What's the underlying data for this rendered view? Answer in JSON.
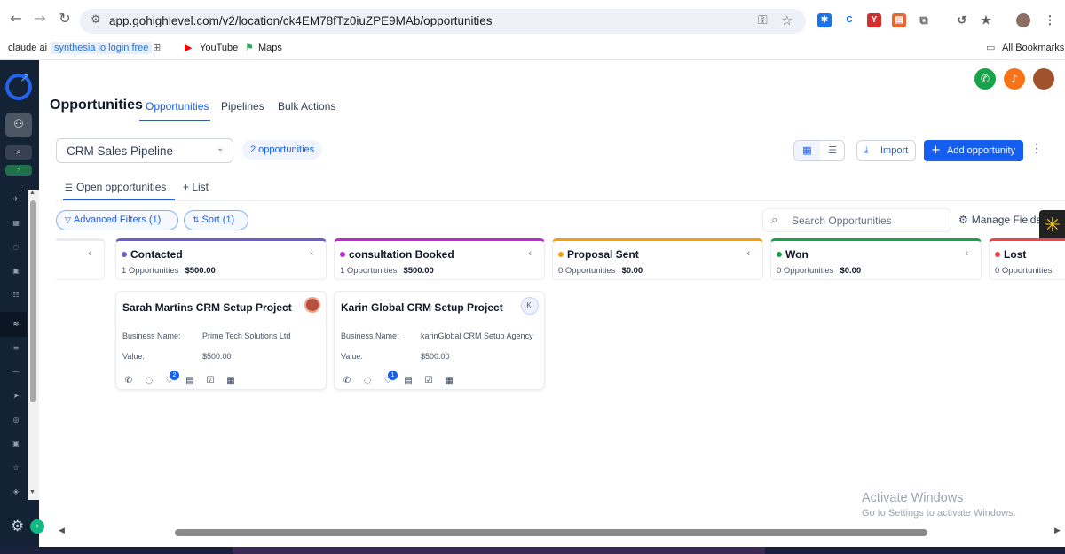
{
  "browser": {
    "url": "app.gohighlevel.com/v2/location/ck4EM78fTz0iuZPE9MAb/opportunities",
    "bookmarks": [
      {
        "label": "claude ai"
      },
      {
        "label": "synthesia io login free"
      },
      {
        "label": "YouTube"
      },
      {
        "label": "Maps"
      }
    ],
    "all_bookmarks": "All Bookmarks"
  },
  "header": {
    "title": "Opportunities",
    "tabs": [
      {
        "label": "Opportunities",
        "active": true
      },
      {
        "label": "Pipelines"
      },
      {
        "label": "Bulk Actions"
      }
    ]
  },
  "toolbar": {
    "pipeline_selected": "CRM Sales Pipeline",
    "opportunity_count": "2 opportunities",
    "import_label": "Import",
    "add_label": "Add opportunity"
  },
  "subtabs": {
    "open": "Open opportunities",
    "add_list": "+ List"
  },
  "filters": {
    "advanced": "Advanced Filters (1)",
    "sort": "Sort (1)",
    "search_placeholder": "Search Opportunities",
    "manage_fields": "Manage Fields"
  },
  "stages": [
    {
      "name": "Contacted",
      "count": "1 Opportunities",
      "value": "$500.00",
      "color": "#6d5bd0"
    },
    {
      "name": "consultation Booked",
      "count": "1 Opportunities",
      "value": "$500.00",
      "color": "#c026d3"
    },
    {
      "name": "Proposal Sent",
      "count": "0 Opportunities",
      "value": "$0.00",
      "color": "#f59e0b"
    },
    {
      "name": "Won",
      "count": "0 Opportunities",
      "value": "$0.00",
      "color": "#16a34a"
    },
    {
      "name": "Lost",
      "count": "0 Opportunities",
      "value": "",
      "color": "#ef4444"
    }
  ],
  "cards": [
    {
      "title": "Sarah Martins CRM Setup Project",
      "business_label": "Business Name:",
      "business_value": "Prime Tech Solutions Ltd",
      "value_label": "Value:",
      "value": "$500.00",
      "tag_badge": "2"
    },
    {
      "title": "Karin Global CRM Setup Project",
      "initials": "KI",
      "business_label": "Business Name:",
      "business_value": "karinGlobal CRM Setup Agency",
      "value_label": "Value:",
      "value": "$500.00",
      "tag_badge": "1"
    }
  ],
  "windows": {
    "activate_title": "Activate Windows",
    "activate_sub": "Go to Settings to activate Windows."
  }
}
